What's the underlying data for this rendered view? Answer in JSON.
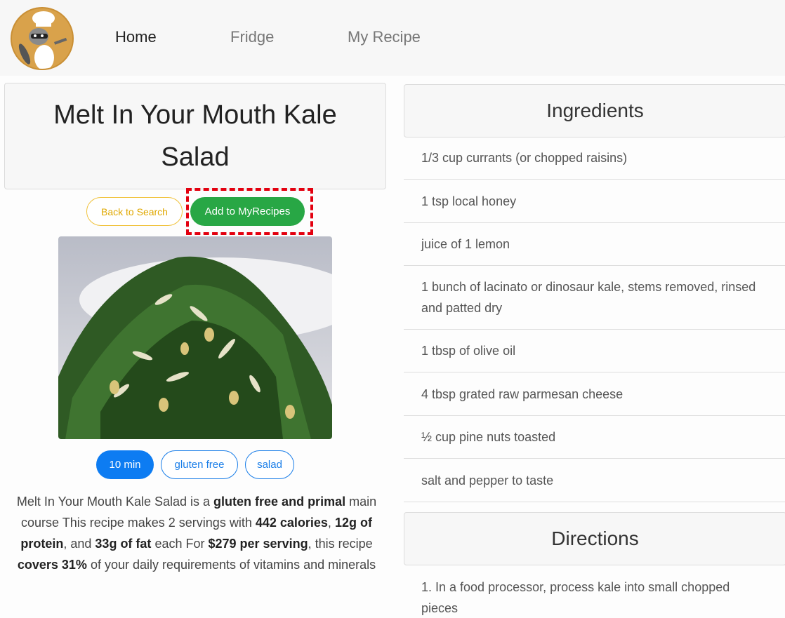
{
  "nav": {
    "links": [
      "Home",
      "Fridge",
      "My Recipe"
    ]
  },
  "recipe": {
    "title": "Melt In Your Mouth Kale Salad",
    "back_label": "Back to Search",
    "add_label": "Add to MyRecipes",
    "tags": [
      "10 min",
      "gluten free",
      "salad"
    ],
    "summary": {
      "p1": "Melt In Your Mouth Kale Salad is a ",
      "b1": "gluten free and primal",
      "p2": " main course This recipe makes 2 servings with ",
      "b2": "442 calories",
      "p3": ", ",
      "b3": "12g of protein",
      "p4": ", and ",
      "b4": "33g of fat",
      "p5": " each For ",
      "b5": "$279 per serving",
      "p6": ", this recipe ",
      "b6": "covers 31%",
      "p7": " of your daily requirements of vitamins and minerals"
    }
  },
  "ingredients": {
    "header": "Ingredients",
    "items": [
      "1/3 cup currants (or chopped raisins)",
      "1 tsp local honey",
      "juice of 1 lemon",
      "1 bunch of lacinato or dinosaur kale, stems removed, rinsed and patted dry",
      "1 tbsp of olive oil",
      "4 tbsp grated raw parmesan cheese",
      "½ cup pine nuts toasted",
      "salt and pepper to taste"
    ]
  },
  "directions": {
    "header": "Directions",
    "items": [
      "1. In a food processor, process kale into small chopped pieces"
    ]
  },
  "colors": {
    "success": "#28a745",
    "primary": "#0d7cf2",
    "warning": "#f0c23b",
    "highlight": "#e3000f"
  }
}
